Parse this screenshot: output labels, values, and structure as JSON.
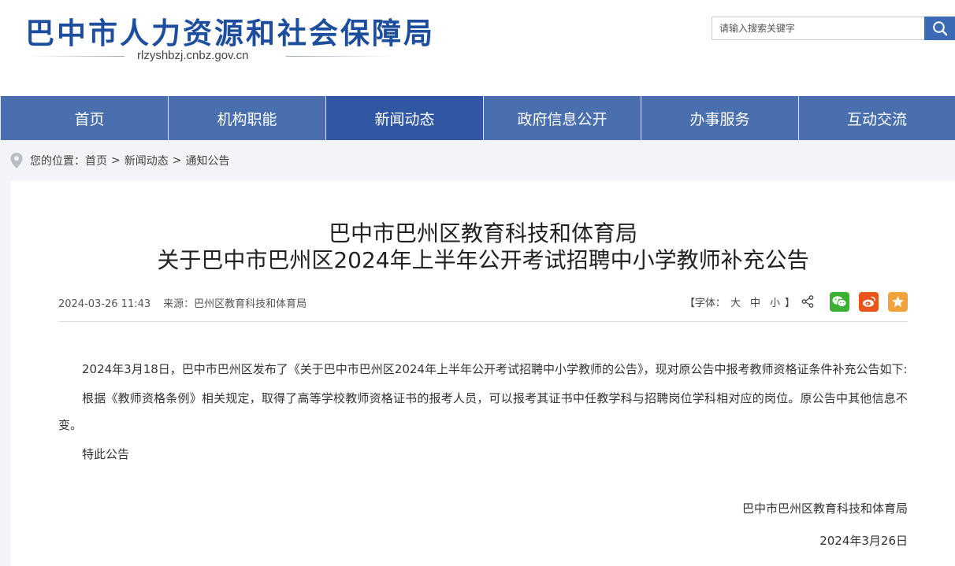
{
  "header": {
    "site_title": "巴中市人力资源和社会保障局",
    "domain": "rlzyshbzj.cnbz.gov.cn",
    "search_placeholder": "请输入搜索关键字",
    "search_icon": "search-icon"
  },
  "nav": {
    "items": [
      {
        "label": "首页"
      },
      {
        "label": "机构职能"
      },
      {
        "label": "新闻动态"
      },
      {
        "label": "政府信息公开"
      },
      {
        "label": "办事服务"
      },
      {
        "label": "互动交流"
      }
    ],
    "active_index": 2
  },
  "breadcrumb": {
    "prefix": "您的位置：",
    "items": [
      "首页",
      "新闻动态",
      "通知公告"
    ],
    "separator": ">"
  },
  "article": {
    "title_line1": "巴中市巴州区教育科技和体育局",
    "title_line2": "关于巴中市巴州区2024年上半年公开考试招聘中小学教师补充公告",
    "date": "2024-03-26 11:43",
    "source_label": "来源：",
    "source": "巴州区教育科技和体育局",
    "font_size_label_open": "【字体：",
    "font_large": "大",
    "font_medium": "中",
    "font_small": "小",
    "font_size_label_close": "】",
    "paragraphs": [
      "2024年3月18日，巴中市巴州区发布了《关于巴中市巴州区2024年上半年公开考试招聘中小学教师的公告》，现对原公告中报考教师资格证条件补充公告如下:",
      "根据《教师资格条例》相关规定，取得了高等学校教师资格证书的报考人员，可以报考其证书中任教学科与招聘岗位学科相对应的岗位。原公告中其他信息不变。",
      "特此公告"
    ],
    "signature": "巴中市巴州区教育科技和体育局",
    "sign_date": "2024年3月26日"
  },
  "colors": {
    "brand": "#1d4e9e",
    "nav_bg": "#4a6fae",
    "nav_active": "#3156a4",
    "wechat": "#3cb034",
    "weibo": "#e9541c",
    "favorite": "#f2a23a"
  }
}
